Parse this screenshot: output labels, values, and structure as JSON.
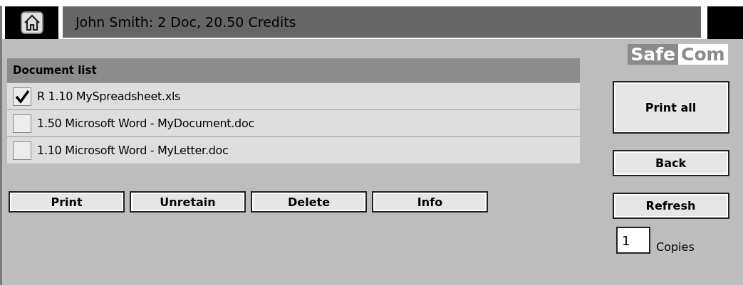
{
  "header": {
    "title": "John Smith: 2 Doc, 20.50 Credits"
  },
  "logo": {
    "left": "Safe",
    "right": "Com"
  },
  "document_list": {
    "title": "Document list",
    "rows": [
      {
        "label": "R 1.10 MySpreadsheet.xls",
        "checked": true
      },
      {
        "label": "1.50 Microsoft Word - MyDocument.doc",
        "checked": false
      },
      {
        "label": "1.10 Microsoft Word - MyLetter.doc",
        "checked": false
      }
    ]
  },
  "bottom_buttons": [
    "Print",
    "Unretain",
    "Delete",
    "Info"
  ],
  "side_buttons": [
    {
      "label": "Print all",
      "kind": "large"
    },
    {
      "label": "Back",
      "kind": "small"
    },
    {
      "label": "Refresh",
      "kind": "small"
    }
  ],
  "copies": {
    "value": "1",
    "label": "Copies"
  }
}
